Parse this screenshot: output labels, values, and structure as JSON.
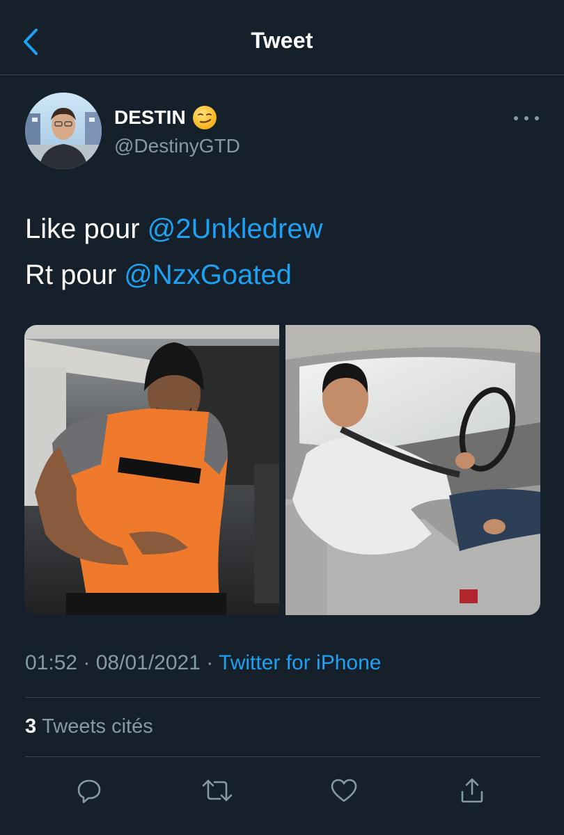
{
  "header": {
    "title": "Tweet",
    "back_icon": "chevron-left-icon"
  },
  "author": {
    "display_name": "DESTIN",
    "emoji": "smirking-face-emoji",
    "handle": "@DestinyGTD"
  },
  "tweet": {
    "line1_prefix": "Like pour ",
    "line1_mention": "@2Unkledrew",
    "line2_prefix": "Rt pour ",
    "line2_mention": "@NzxGoated",
    "media": [
      {
        "description_name": "photo-man-orange-shirt"
      },
      {
        "description_name": "photo-young-man-in-car"
      }
    ]
  },
  "meta": {
    "time": "01:52",
    "sep1": " · ",
    "date": "08/01/2021",
    "sep2": " · ",
    "source": "Twitter for iPhone"
  },
  "quotes": {
    "count": "3",
    "label": "Tweets cités"
  },
  "actions": [
    "reply-icon",
    "retweet-icon",
    "like-icon",
    "share-icon"
  ],
  "colors": {
    "background": "#15202b",
    "accent": "#1da1f2",
    "secondary_text": "#8899a6",
    "divider": "#38444d"
  }
}
